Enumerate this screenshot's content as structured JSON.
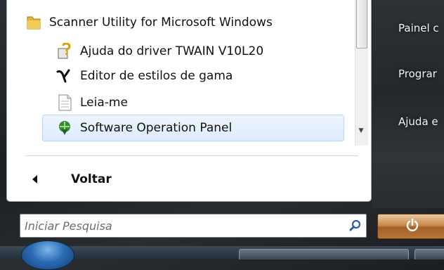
{
  "programs": {
    "folder": {
      "label": "Scanner Utility for Microsoft Windows",
      "icon": "folder-icon"
    },
    "items": [
      {
        "label": "Ajuda do driver TWAIN V10L20",
        "icon": "help-icon"
      },
      {
        "label": "Editor de estilos de gama",
        "icon": "gamma-editor-icon"
      },
      {
        "label": "Leia-me",
        "icon": "document-icon"
      },
      {
        "label": "Software Operation Panel",
        "icon": "operation-panel-icon"
      }
    ],
    "back_label": "Voltar"
  },
  "right_pane": {
    "items": [
      "Painel c",
      "Prograr",
      "Ajuda e"
    ]
  },
  "search": {
    "placeholder": "Iniciar Pesquisa"
  },
  "colors": {
    "accent_selection": "#dcebfc",
    "power_button": "#c98a4b",
    "taskbar": "#24303b"
  }
}
